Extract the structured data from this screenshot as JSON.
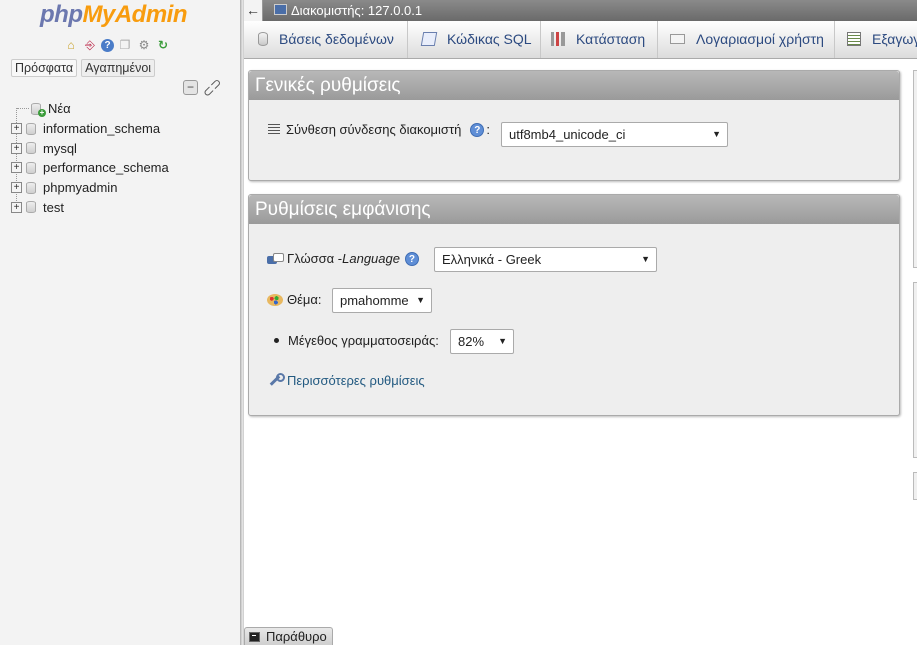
{
  "logo": {
    "php": "php",
    "myadmin": "MyAdmin"
  },
  "nav": {
    "icons": [
      "home-icon",
      "exit-icon",
      "help-icon",
      "docs-icon",
      "settings-icon",
      "reload-icon"
    ],
    "tabs": {
      "recent": "Πρόσφατα",
      "favorites": "Αγαπημένοι"
    },
    "tree": {
      "new_label": "Νέα",
      "databases": [
        "information_schema",
        "mysql",
        "performance_schema",
        "phpmyadmin",
        "test"
      ]
    }
  },
  "topbar": {
    "server_label": "Διακομιστής: 127.0.0.1"
  },
  "tabs": {
    "databases": "Βάσεις δεδομένων",
    "sql": "Κώδικας SQL",
    "status": "Κατάσταση",
    "users": "Λογαριασμοί χρήστη",
    "export": "Εξαγωγή"
  },
  "general": {
    "title": "Γενικές ρυθμίσεις",
    "collation_label": "Σύνθεση σύνδεσης διακομιστή",
    "collation_value": "utf8mb4_unicode_ci"
  },
  "appearance": {
    "title": "Ρυθμίσεις εμφάνισης",
    "language_label": "Γλώσσα - ",
    "language_label_en": "Language",
    "language_value": "Ελληνικά - Greek",
    "theme_label": "Θέμα:",
    "theme_value": "pmahomme",
    "font_size_label": "Μέγεθος γραμματοσειράς:",
    "font_size_value": "82%",
    "more_settings": "Περισσότερες ρυθμίσεις"
  },
  "console": {
    "label": "Παράθυρο"
  },
  "colors": {
    "link": "#235a81",
    "tab_text": "#2c4a80",
    "panel_head": "#a8a8a8"
  }
}
